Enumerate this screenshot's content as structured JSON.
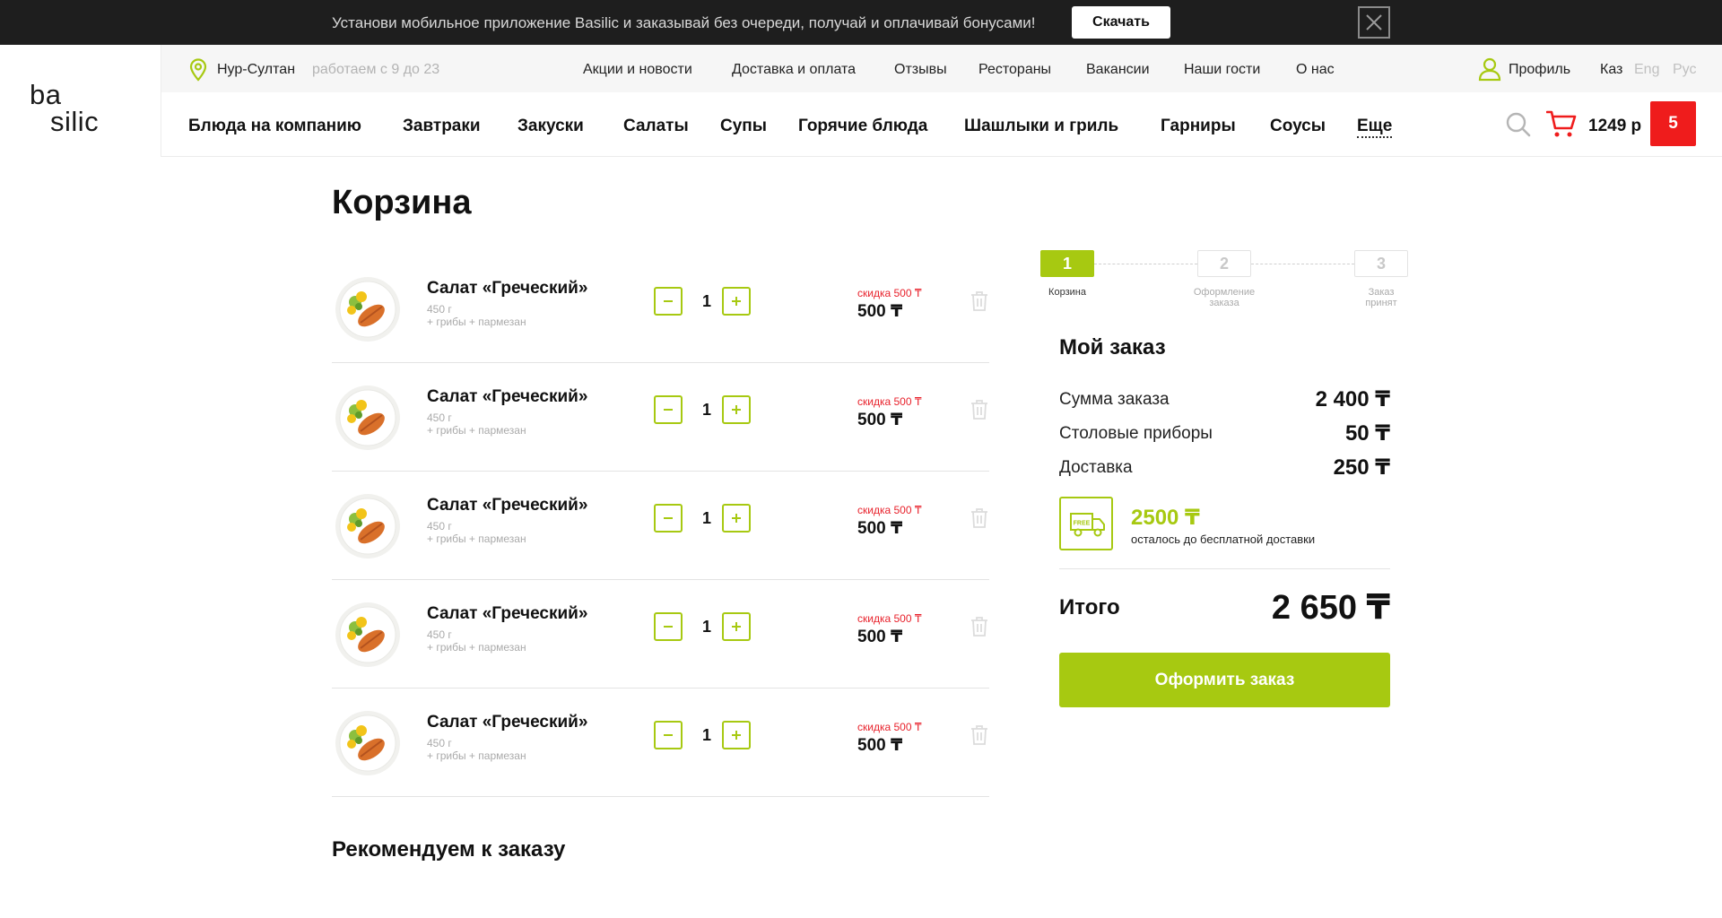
{
  "banner": {
    "text": "Установи мобильное приложение Basilic и заказывай без очереди, получай и оплачивай бонусами!",
    "download_label": "Скачать"
  },
  "logo": {
    "line1": "ba",
    "line2": "silic"
  },
  "infobar": {
    "city": "Нур-Султан",
    "hours": "работаем с 9 до 23",
    "links": [
      "Акции и новости",
      "Доставка и оплата",
      "Отзывы",
      "Рестораны",
      "Вакансии",
      "Наши гости",
      "О нас"
    ],
    "profile": "Профиль",
    "languages": [
      "Каз",
      "Eng",
      "Рус"
    ]
  },
  "categories": [
    "Блюда на компанию",
    "Завтраки",
    "Закуски",
    "Салаты",
    "Супы",
    "Горячие блюда",
    "Шашлыки и гриль",
    "Гарниры",
    "Соусы",
    "Еще"
  ],
  "cart": {
    "total": "1249 р",
    "count": "5"
  },
  "page_title": "Корзина",
  "items": [
    {
      "name": "Салат «Греческий»",
      "weight": "450 г",
      "extras": "+ грибы + пармезан",
      "quantity": "1",
      "discount": "скидка 500 ₸",
      "price": "500 ₸"
    },
    {
      "name": "Салат «Греческий»",
      "weight": "450 г",
      "extras": "+ грибы + пармезан",
      "quantity": "1",
      "discount": "скидка 500 ₸",
      "price": "500 ₸"
    },
    {
      "name": "Салат «Греческий»",
      "weight": "450 г",
      "extras": "+ грибы + пармезан",
      "quantity": "1",
      "discount": "скидка 500 ₸",
      "price": "500 ₸"
    },
    {
      "name": "Салат «Греческий»",
      "weight": "450 г",
      "extras": "+ грибы + пармезан",
      "quantity": "1",
      "discount": "скидка 500 ₸",
      "price": "500 ₸"
    },
    {
      "name": "Салат «Греческий»",
      "weight": "450 г",
      "extras": "+ грибы + пармезан",
      "quantity": "1",
      "discount": "скидка 500 ₸",
      "price": "500 ₸"
    }
  ],
  "steps": [
    {
      "number": "1",
      "label1": "Корзина",
      "label2": "",
      "active": true
    },
    {
      "number": "2",
      "label1": "Оформление",
      "label2": "заказа",
      "active": false
    },
    {
      "number": "3",
      "label1": "Заказ",
      "label2": "принят",
      "active": false
    }
  ],
  "order": {
    "title": "Мой заказ",
    "rows": [
      {
        "label": "Сумма заказа",
        "value": "2 400 ₸"
      },
      {
        "label": "Столовые приборы",
        "value": "50 ₸"
      },
      {
        "label": "Доставка",
        "value": "250 ₸"
      }
    ],
    "free_delivery_amount": "2500 ₸",
    "free_delivery_text": "осталось до бесплатной доставки",
    "truck_badge": "FREE",
    "total_label": "Итого",
    "total_value": "2 650 ₸",
    "checkout_label": "Оформить заказ"
  },
  "recommend_title": "Рекомендуем к заказу",
  "colors": {
    "accent": "#a7c911",
    "danger": "#e8212b",
    "banner_bg": "#1e1e1e",
    "cart_badge": "#ef1c1c"
  }
}
